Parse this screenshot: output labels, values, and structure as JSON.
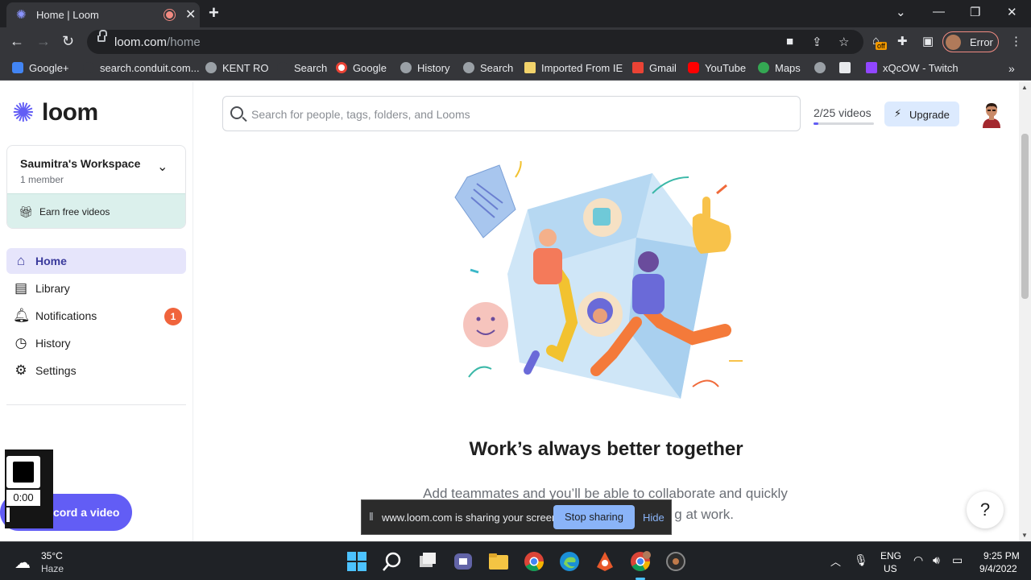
{
  "browser": {
    "tab_title": "Home | Loom",
    "tab_close": "✕",
    "new_tab": "+",
    "url_host": "loom.com",
    "url_path": "/home",
    "profile_label": "Error",
    "ext_badge": "off"
  },
  "bookmarks": [
    {
      "label": "Google+",
      "icon_color": "#4285f4"
    },
    {
      "label": "search.conduit.com...",
      "icon_color": "#35363a"
    },
    {
      "label": "KENT RO",
      "icon_color": "#9aa0a6"
    },
    {
      "label": "Search",
      "icon_color": "#35363a"
    },
    {
      "label": "Google",
      "icon_color": "#ffffff"
    },
    {
      "label": "History",
      "icon_color": "#9aa0a6"
    },
    {
      "label": "Search",
      "icon_color": "#9aa0a6"
    },
    {
      "label": "Imported From IE",
      "icon_color": "#f2d36b"
    },
    {
      "label": "Gmail",
      "icon_color": "#ea4335"
    },
    {
      "label": "YouTube",
      "icon_color": "#ff0000"
    },
    {
      "label": "Maps",
      "icon_color": "#34a853"
    },
    {
      "label": "",
      "icon_color": "#9aa0a6"
    },
    {
      "label": "",
      "icon_color": "#e8eaed"
    },
    {
      "label": "xQcOW - Twitch",
      "icon_color": "#9146ff"
    }
  ],
  "sidebar": {
    "logo": "loom",
    "workspace_name": "Saumitra's Workspace",
    "workspace_members": "1 member",
    "earn_label": "Earn free videos",
    "nav": [
      {
        "label": "Home",
        "icon": "home-icon"
      },
      {
        "label": "Library",
        "icon": "library-icon"
      },
      {
        "label": "Notifications",
        "icon": "bell-icon",
        "badge": "1"
      },
      {
        "label": "History",
        "icon": "clock-icon"
      },
      {
        "label": "Settings",
        "icon": "gear-icon"
      }
    ],
    "record_label": "cord a video",
    "timer": "0:00"
  },
  "header": {
    "search_placeholder": "Search for people, tags, folders, and Looms",
    "videos_count": "2/25 videos",
    "videos_progress": 0.08,
    "upgrade_label": "Upgrade"
  },
  "main": {
    "headline": "Work’s always better together",
    "subline": "Add teammates and you’ll be able to collaborate and quickly",
    "subline_2": "g at work."
  },
  "help_label": "?",
  "share_bar": {
    "message": "www.loom.com is sharing your screen.",
    "stop_label": "Stop sharing",
    "hide_label": "Hide"
  },
  "taskbar": {
    "temperature": "35°C",
    "weather": "Haze",
    "lang": "ENG",
    "region": "US",
    "time": "9:25 PM",
    "date": "9/4/2022"
  },
  "colors": {
    "brand": "#625df5",
    "badge": "#f0643c",
    "earn_bg": "#dbf0ec",
    "upgrade_bg": "#dceafe"
  }
}
